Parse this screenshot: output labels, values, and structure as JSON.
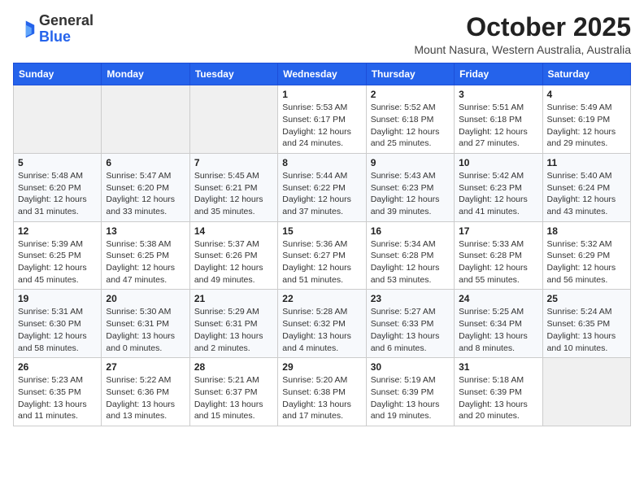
{
  "header": {
    "logo_general": "General",
    "logo_blue": "Blue",
    "month_title": "October 2025",
    "subtitle": "Mount Nasura, Western Australia, Australia"
  },
  "days_of_week": [
    "Sunday",
    "Monday",
    "Tuesday",
    "Wednesday",
    "Thursday",
    "Friday",
    "Saturday"
  ],
  "weeks": [
    [
      {
        "day": "",
        "info": ""
      },
      {
        "day": "",
        "info": ""
      },
      {
        "day": "",
        "info": ""
      },
      {
        "day": "1",
        "info": "Sunrise: 5:53 AM\nSunset: 6:17 PM\nDaylight: 12 hours\nand 24 minutes."
      },
      {
        "day": "2",
        "info": "Sunrise: 5:52 AM\nSunset: 6:18 PM\nDaylight: 12 hours\nand 25 minutes."
      },
      {
        "day": "3",
        "info": "Sunrise: 5:51 AM\nSunset: 6:18 PM\nDaylight: 12 hours\nand 27 minutes."
      },
      {
        "day": "4",
        "info": "Sunrise: 5:49 AM\nSunset: 6:19 PM\nDaylight: 12 hours\nand 29 minutes."
      }
    ],
    [
      {
        "day": "5",
        "info": "Sunrise: 5:48 AM\nSunset: 6:20 PM\nDaylight: 12 hours\nand 31 minutes."
      },
      {
        "day": "6",
        "info": "Sunrise: 5:47 AM\nSunset: 6:20 PM\nDaylight: 12 hours\nand 33 minutes."
      },
      {
        "day": "7",
        "info": "Sunrise: 5:45 AM\nSunset: 6:21 PM\nDaylight: 12 hours\nand 35 minutes."
      },
      {
        "day": "8",
        "info": "Sunrise: 5:44 AM\nSunset: 6:22 PM\nDaylight: 12 hours\nand 37 minutes."
      },
      {
        "day": "9",
        "info": "Sunrise: 5:43 AM\nSunset: 6:23 PM\nDaylight: 12 hours\nand 39 minutes."
      },
      {
        "day": "10",
        "info": "Sunrise: 5:42 AM\nSunset: 6:23 PM\nDaylight: 12 hours\nand 41 minutes."
      },
      {
        "day": "11",
        "info": "Sunrise: 5:40 AM\nSunset: 6:24 PM\nDaylight: 12 hours\nand 43 minutes."
      }
    ],
    [
      {
        "day": "12",
        "info": "Sunrise: 5:39 AM\nSunset: 6:25 PM\nDaylight: 12 hours\nand 45 minutes."
      },
      {
        "day": "13",
        "info": "Sunrise: 5:38 AM\nSunset: 6:25 PM\nDaylight: 12 hours\nand 47 minutes."
      },
      {
        "day": "14",
        "info": "Sunrise: 5:37 AM\nSunset: 6:26 PM\nDaylight: 12 hours\nand 49 minutes."
      },
      {
        "day": "15",
        "info": "Sunrise: 5:36 AM\nSunset: 6:27 PM\nDaylight: 12 hours\nand 51 minutes."
      },
      {
        "day": "16",
        "info": "Sunrise: 5:34 AM\nSunset: 6:28 PM\nDaylight: 12 hours\nand 53 minutes."
      },
      {
        "day": "17",
        "info": "Sunrise: 5:33 AM\nSunset: 6:28 PM\nDaylight: 12 hours\nand 55 minutes."
      },
      {
        "day": "18",
        "info": "Sunrise: 5:32 AM\nSunset: 6:29 PM\nDaylight: 12 hours\nand 56 minutes."
      }
    ],
    [
      {
        "day": "19",
        "info": "Sunrise: 5:31 AM\nSunset: 6:30 PM\nDaylight: 12 hours\nand 58 minutes."
      },
      {
        "day": "20",
        "info": "Sunrise: 5:30 AM\nSunset: 6:31 PM\nDaylight: 13 hours\nand 0 minutes."
      },
      {
        "day": "21",
        "info": "Sunrise: 5:29 AM\nSunset: 6:31 PM\nDaylight: 13 hours\nand 2 minutes."
      },
      {
        "day": "22",
        "info": "Sunrise: 5:28 AM\nSunset: 6:32 PM\nDaylight: 13 hours\nand 4 minutes."
      },
      {
        "day": "23",
        "info": "Sunrise: 5:27 AM\nSunset: 6:33 PM\nDaylight: 13 hours\nand 6 minutes."
      },
      {
        "day": "24",
        "info": "Sunrise: 5:25 AM\nSunset: 6:34 PM\nDaylight: 13 hours\nand 8 minutes."
      },
      {
        "day": "25",
        "info": "Sunrise: 5:24 AM\nSunset: 6:35 PM\nDaylight: 13 hours\nand 10 minutes."
      }
    ],
    [
      {
        "day": "26",
        "info": "Sunrise: 5:23 AM\nSunset: 6:35 PM\nDaylight: 13 hours\nand 11 minutes."
      },
      {
        "day": "27",
        "info": "Sunrise: 5:22 AM\nSunset: 6:36 PM\nDaylight: 13 hours\nand 13 minutes."
      },
      {
        "day": "28",
        "info": "Sunrise: 5:21 AM\nSunset: 6:37 PM\nDaylight: 13 hours\nand 15 minutes."
      },
      {
        "day": "29",
        "info": "Sunrise: 5:20 AM\nSunset: 6:38 PM\nDaylight: 13 hours\nand 17 minutes."
      },
      {
        "day": "30",
        "info": "Sunrise: 5:19 AM\nSunset: 6:39 PM\nDaylight: 13 hours\nand 19 minutes."
      },
      {
        "day": "31",
        "info": "Sunrise: 5:18 AM\nSunset: 6:39 PM\nDaylight: 13 hours\nand 20 minutes."
      },
      {
        "day": "",
        "info": ""
      }
    ]
  ]
}
